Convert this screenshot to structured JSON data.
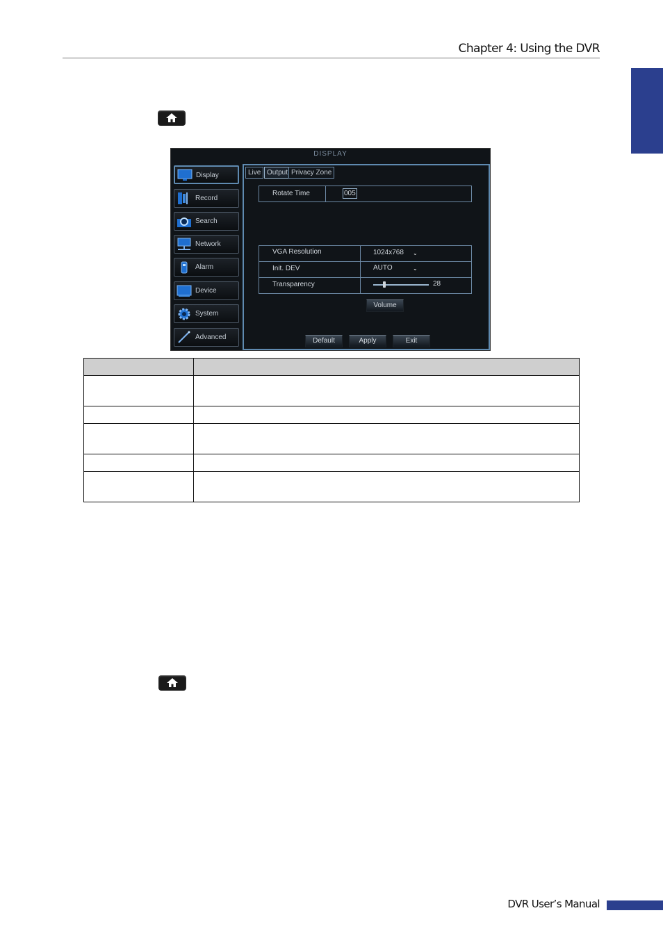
{
  "header": {
    "chapter": "Chapter 4: Using the DVR"
  },
  "footer": {
    "manual": "DVR User’s Manual"
  },
  "icons": {
    "home": "home-icon"
  },
  "colors": {
    "accent": "#2b3f8e",
    "dvr_frame": "#5f8ab0"
  },
  "dvr": {
    "title": "DISPLAY",
    "menu": [
      {
        "label": "Display",
        "icon": "monitor-icon",
        "active": true
      },
      {
        "label": "Record",
        "icon": "record-icon"
      },
      {
        "label": "Search",
        "icon": "search-icon"
      },
      {
        "label": "Network",
        "icon": "network-icon"
      },
      {
        "label": "Alarm",
        "icon": "alarm-icon"
      },
      {
        "label": "Device",
        "icon": "device-icon"
      },
      {
        "label": "System",
        "icon": "gear-icon"
      },
      {
        "label": "Advanced",
        "icon": "wand-icon"
      }
    ],
    "tabs": [
      {
        "label": "Live"
      },
      {
        "label": "Output",
        "active": true
      },
      {
        "label": "Privacy Zone"
      }
    ],
    "rotate": {
      "label": "Rotate Time",
      "value": "005"
    },
    "settings": [
      {
        "label": "VGA Resolution",
        "value": "1024x768"
      },
      {
        "label": "Init. DEV",
        "value": "AUTO"
      },
      {
        "label": "Transparency",
        "value": "28",
        "level": 0.2
      }
    ],
    "volume_label": "Volume",
    "buttons": {
      "default": "Default",
      "apply": "Apply",
      "exit": "Exit"
    }
  }
}
